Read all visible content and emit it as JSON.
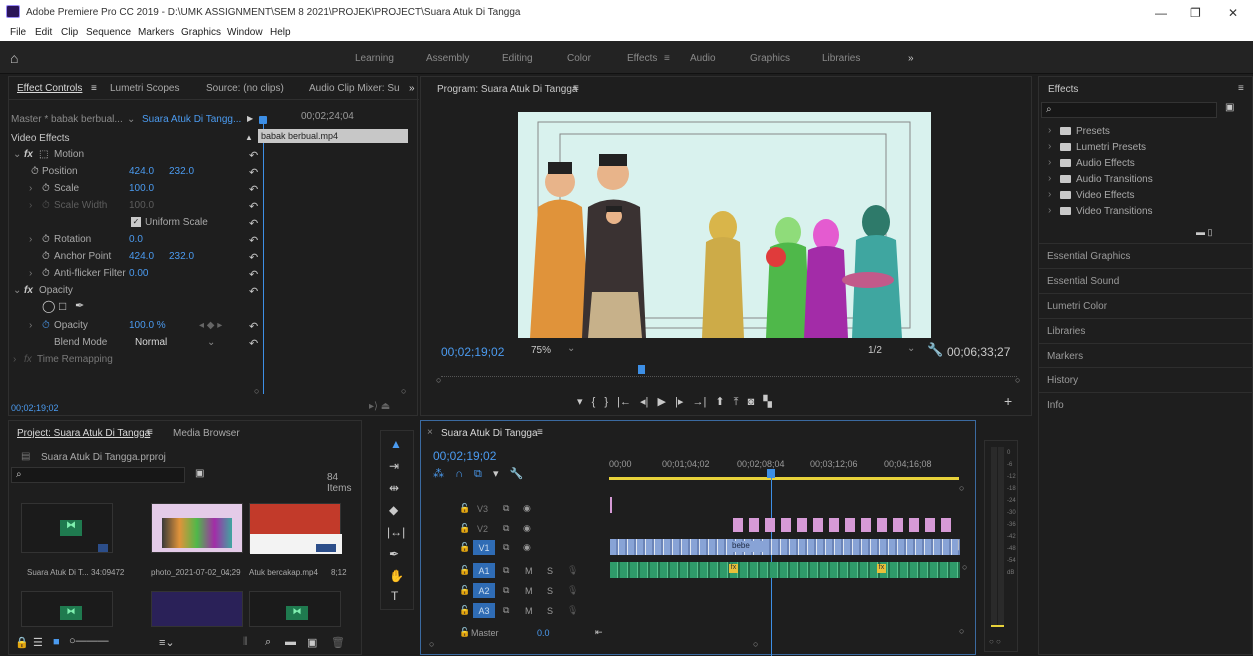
{
  "window": {
    "title": "Adobe Premiere Pro CC 2019 - D:\\UMK ASSIGNMENT\\SEM 8 2021\\PROJEK\\PROJECT\\Suara Atuk Di Tangga",
    "minimize": "—",
    "maximize": "❐",
    "close": "✕"
  },
  "menu": [
    "File",
    "Edit",
    "Clip",
    "Sequence",
    "Markers",
    "Graphics",
    "Window",
    "Help"
  ],
  "workspaces": [
    "Learning",
    "Assembly",
    "Editing",
    "Color",
    "Effects",
    "Audio",
    "Graphics",
    "Libraries"
  ],
  "workspace_active": "Effects",
  "workspace_more": "»",
  "effect_controls": {
    "tabs": [
      "Effect Controls",
      "Lumetri Scopes",
      "Source: (no clips)",
      "Audio Clip Mixer: Su"
    ],
    "more": "»",
    "master": "Master * babak berbual...",
    "sequence": "Suara Atuk Di Tangg...",
    "timecode_top": "00;02;24;04",
    "clip_label": "babak berbual.mp4",
    "section": "Video Effects",
    "motion": "Motion",
    "position_label": "Position",
    "position_x": "424.0",
    "position_y": "232.0",
    "scale_label": "Scale",
    "scale_value": "100.0",
    "scale_width_label": "Scale Width",
    "scale_width_value": "100.0",
    "uniform_scale": "Uniform Scale",
    "rotation_label": "Rotation",
    "rotation_value": "0.0",
    "anchor_label": "Anchor Point",
    "anchor_x": "424.0",
    "anchor_y": "232.0",
    "antiflicker_label": "Anti-flicker Filter",
    "antiflicker_value": "0.00",
    "opacity_section": "Opacity",
    "opacity_label": "Opacity",
    "opacity_value": "100.0 %",
    "blend_label": "Blend Mode",
    "blend_value": "Normal",
    "time_remap": "Time Remapping",
    "timecode_bottom": "00;02;19;02"
  },
  "program": {
    "title": "Program: Suara Atuk Di Tangga",
    "timecode": "00;02;19;02",
    "zoom": "75%",
    "resolution": "1/2",
    "duration": "00;06;33;27"
  },
  "effects_panel": {
    "title": "Effects",
    "folders": [
      "Presets",
      "Lumetri Presets",
      "Audio Effects",
      "Audio Transitions",
      "Video Effects",
      "Video Transitions"
    ],
    "side_panels": [
      "Essential Graphics",
      "Essential Sound",
      "Lumetri Color",
      "Libraries",
      "Markers",
      "History",
      "Info"
    ]
  },
  "project": {
    "tabs": [
      "Project: Suara Atuk Di Tangga",
      "Media Browser"
    ],
    "file": "Suara Atuk Di Tangga.prproj",
    "items_count": "84 Items",
    "items": [
      {
        "name": "Suara Atuk Di T...",
        "duration": "34:09472"
      },
      {
        "name": "photo_2021-07-02_0...",
        "duration": "4;29"
      },
      {
        "name": "Atuk bercakap.mp4",
        "duration": "8;12"
      }
    ]
  },
  "timeline": {
    "title": "Suara Atuk Di Tangga",
    "timecode": "00;02;19;02",
    "ruler": [
      "00;00",
      "00;01;04;02",
      "00;02;08;04",
      "00;03;12;06",
      "00;04;16;08"
    ],
    "tracks": [
      {
        "name": "V3"
      },
      {
        "name": "V2"
      },
      {
        "name": "V1"
      },
      {
        "name": "A1"
      },
      {
        "name": "A2"
      },
      {
        "name": "A3"
      }
    ],
    "master_label": "Master",
    "master_value": "0.0",
    "clip_label": "bebe",
    "fx_badge": "fx",
    "meter_scale": [
      "0",
      "-6",
      "-12",
      "-18",
      "-24",
      "-30",
      "-36",
      "-42",
      "-48",
      "-54",
      "dB"
    ]
  },
  "colors": {
    "accent": "#4b9bf0",
    "playhead": "#3d8fe6",
    "video_clip": "#88a3d6",
    "audio_clip": "#2f9a6a",
    "v2_clip": "#d69ad6",
    "work_area": "#e8d23a"
  }
}
